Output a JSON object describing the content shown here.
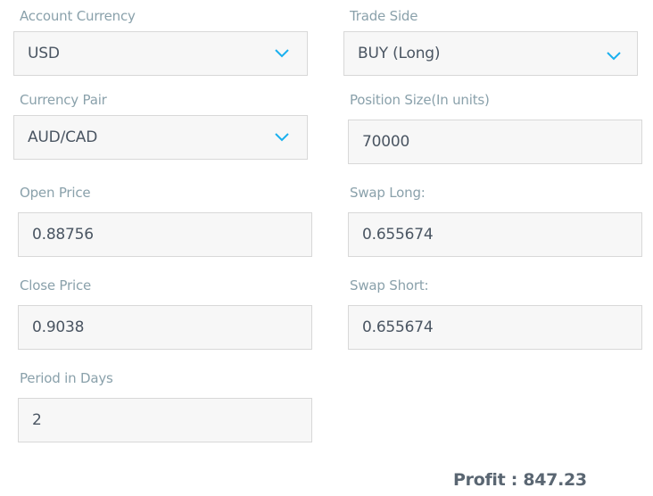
{
  "form": {
    "account_currency": {
      "label": "Account Currency",
      "value": "USD"
    },
    "trade_side": {
      "label": "Trade Side",
      "value": "BUY (Long)"
    },
    "currency_pair": {
      "label": "Currency Pair",
      "value": "AUD/CAD"
    },
    "position_size": {
      "label": "Position Size(In units)",
      "value": "70000"
    },
    "open_price": {
      "label": "Open Price",
      "value": "0.88756"
    },
    "swap_long": {
      "label": "Swap Long:",
      "value": "0.655674"
    },
    "close_price": {
      "label": "Close Price",
      "value": "0.9038"
    },
    "swap_short": {
      "label": "Swap Short:",
      "value": "0.655674"
    },
    "period_days": {
      "label": "Period in Days",
      "value": "2"
    }
  },
  "result": {
    "profit_text": "Profit : 847.23"
  },
  "icons": {
    "dropdown": "chevron-down-icon"
  },
  "colors": {
    "accent": "#1ab0ef",
    "label": "#8aa1ab",
    "value": "#4a5562"
  }
}
